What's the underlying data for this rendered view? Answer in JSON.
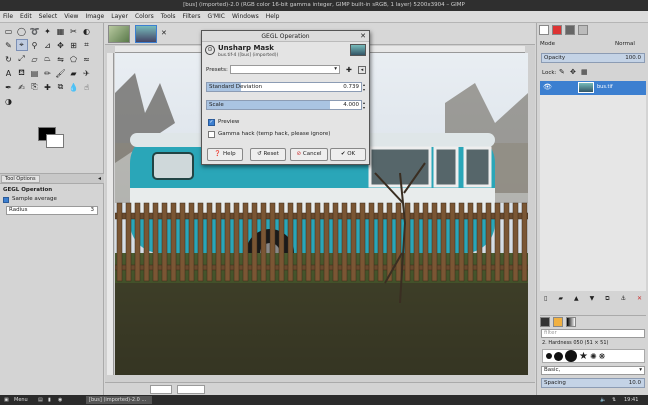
{
  "window": {
    "title": "[bus] (imported)-2.0 (RGB color 16-bit gamma integer, GIMP built-in sRGB, 1 layer) 5200x3904 – GIMP"
  },
  "menubar": {
    "items": [
      "File",
      "Edit",
      "Select",
      "View",
      "Image",
      "Layer",
      "Colors",
      "Tools",
      "Filters",
      "G'MIC",
      "Windows",
      "Help"
    ]
  },
  "tool_options": {
    "tab_label": "Tool Options",
    "heading": "GEGL Operation",
    "sample_average": "Sample average",
    "radius_label": "Radius",
    "radius_value": "3"
  },
  "dialog": {
    "title": "GEGL Operation",
    "filter_name": "Unsharp Mask",
    "filter_sub": "bus.tif-4 ([bus] (imported))",
    "presets_label": "Presets:",
    "std_dev_label": "Standard Deviation",
    "std_dev_value": "0.739",
    "std_dev_fraction": 0.22,
    "scale_label": "Scale",
    "scale_value": "4.000",
    "scale_fraction": 0.8,
    "preview_label": "Preview",
    "preview_checked": true,
    "gamma_label": "Gamma hack (temp hack, please ignore)",
    "gamma_checked": false,
    "buttons": {
      "help": "Help",
      "reset": "Reset",
      "cancel": "Cancel",
      "ok": "OK"
    }
  },
  "layers": {
    "mode_label": "Mode",
    "mode_value": "Normal",
    "opacity_label": "Opacity",
    "opacity_value": "100.0",
    "lock_label": "Lock:",
    "layer_name": "bus.tif"
  },
  "brushes": {
    "filter_placeholder": "filter",
    "brush_name": "2. Hardness 050 (51 × 51)",
    "category": "Basic,",
    "spacing_label": "Spacing",
    "spacing_value": "10.0"
  },
  "taskbar": {
    "menu_label": "Menu",
    "task_label": "[bus] (imported)-2.0 ...",
    "clock": "19:41"
  },
  "colors": {
    "accent": "#3c7fd0",
    "fg": "#000000",
    "bg": "#ffffff"
  }
}
